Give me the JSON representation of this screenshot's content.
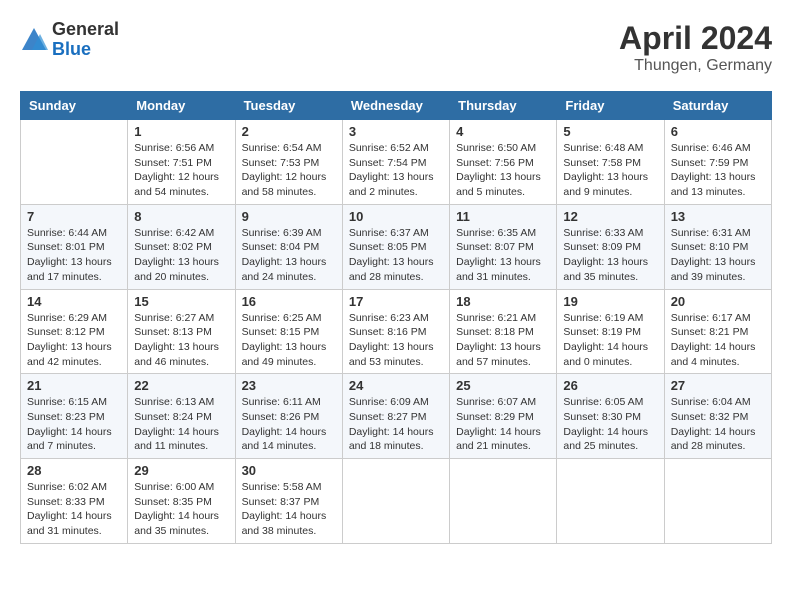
{
  "header": {
    "logo_general": "General",
    "logo_blue": "Blue",
    "month_title": "April 2024",
    "location": "Thungen, Germany"
  },
  "days_of_week": [
    "Sunday",
    "Monday",
    "Tuesday",
    "Wednesday",
    "Thursday",
    "Friday",
    "Saturday"
  ],
  "weeks": [
    [
      {
        "day": "",
        "sunrise": "",
        "sunset": "",
        "daylight": ""
      },
      {
        "day": "1",
        "sunrise": "Sunrise: 6:56 AM",
        "sunset": "Sunset: 7:51 PM",
        "daylight": "Daylight: 12 hours and 54 minutes."
      },
      {
        "day": "2",
        "sunrise": "Sunrise: 6:54 AM",
        "sunset": "Sunset: 7:53 PM",
        "daylight": "Daylight: 12 hours and 58 minutes."
      },
      {
        "day": "3",
        "sunrise": "Sunrise: 6:52 AM",
        "sunset": "Sunset: 7:54 PM",
        "daylight": "Daylight: 13 hours and 2 minutes."
      },
      {
        "day": "4",
        "sunrise": "Sunrise: 6:50 AM",
        "sunset": "Sunset: 7:56 PM",
        "daylight": "Daylight: 13 hours and 5 minutes."
      },
      {
        "day": "5",
        "sunrise": "Sunrise: 6:48 AM",
        "sunset": "Sunset: 7:58 PM",
        "daylight": "Daylight: 13 hours and 9 minutes."
      },
      {
        "day": "6",
        "sunrise": "Sunrise: 6:46 AM",
        "sunset": "Sunset: 7:59 PM",
        "daylight": "Daylight: 13 hours and 13 minutes."
      }
    ],
    [
      {
        "day": "7",
        "sunrise": "Sunrise: 6:44 AM",
        "sunset": "Sunset: 8:01 PM",
        "daylight": "Daylight: 13 hours and 17 minutes."
      },
      {
        "day": "8",
        "sunrise": "Sunrise: 6:42 AM",
        "sunset": "Sunset: 8:02 PM",
        "daylight": "Daylight: 13 hours and 20 minutes."
      },
      {
        "day": "9",
        "sunrise": "Sunrise: 6:39 AM",
        "sunset": "Sunset: 8:04 PM",
        "daylight": "Daylight: 13 hours and 24 minutes."
      },
      {
        "day": "10",
        "sunrise": "Sunrise: 6:37 AM",
        "sunset": "Sunset: 8:05 PM",
        "daylight": "Daylight: 13 hours and 28 minutes."
      },
      {
        "day": "11",
        "sunrise": "Sunrise: 6:35 AM",
        "sunset": "Sunset: 8:07 PM",
        "daylight": "Daylight: 13 hours and 31 minutes."
      },
      {
        "day": "12",
        "sunrise": "Sunrise: 6:33 AM",
        "sunset": "Sunset: 8:09 PM",
        "daylight": "Daylight: 13 hours and 35 minutes."
      },
      {
        "day": "13",
        "sunrise": "Sunrise: 6:31 AM",
        "sunset": "Sunset: 8:10 PM",
        "daylight": "Daylight: 13 hours and 39 minutes."
      }
    ],
    [
      {
        "day": "14",
        "sunrise": "Sunrise: 6:29 AM",
        "sunset": "Sunset: 8:12 PM",
        "daylight": "Daylight: 13 hours and 42 minutes."
      },
      {
        "day": "15",
        "sunrise": "Sunrise: 6:27 AM",
        "sunset": "Sunset: 8:13 PM",
        "daylight": "Daylight: 13 hours and 46 minutes."
      },
      {
        "day": "16",
        "sunrise": "Sunrise: 6:25 AM",
        "sunset": "Sunset: 8:15 PM",
        "daylight": "Daylight: 13 hours and 49 minutes."
      },
      {
        "day": "17",
        "sunrise": "Sunrise: 6:23 AM",
        "sunset": "Sunset: 8:16 PM",
        "daylight": "Daylight: 13 hours and 53 minutes."
      },
      {
        "day": "18",
        "sunrise": "Sunrise: 6:21 AM",
        "sunset": "Sunset: 8:18 PM",
        "daylight": "Daylight: 13 hours and 57 minutes."
      },
      {
        "day": "19",
        "sunrise": "Sunrise: 6:19 AM",
        "sunset": "Sunset: 8:19 PM",
        "daylight": "Daylight: 14 hours and 0 minutes."
      },
      {
        "day": "20",
        "sunrise": "Sunrise: 6:17 AM",
        "sunset": "Sunset: 8:21 PM",
        "daylight": "Daylight: 14 hours and 4 minutes."
      }
    ],
    [
      {
        "day": "21",
        "sunrise": "Sunrise: 6:15 AM",
        "sunset": "Sunset: 8:23 PM",
        "daylight": "Daylight: 14 hours and 7 minutes."
      },
      {
        "day": "22",
        "sunrise": "Sunrise: 6:13 AM",
        "sunset": "Sunset: 8:24 PM",
        "daylight": "Daylight: 14 hours and 11 minutes."
      },
      {
        "day": "23",
        "sunrise": "Sunrise: 6:11 AM",
        "sunset": "Sunset: 8:26 PM",
        "daylight": "Daylight: 14 hours and 14 minutes."
      },
      {
        "day": "24",
        "sunrise": "Sunrise: 6:09 AM",
        "sunset": "Sunset: 8:27 PM",
        "daylight": "Daylight: 14 hours and 18 minutes."
      },
      {
        "day": "25",
        "sunrise": "Sunrise: 6:07 AM",
        "sunset": "Sunset: 8:29 PM",
        "daylight": "Daylight: 14 hours and 21 minutes."
      },
      {
        "day": "26",
        "sunrise": "Sunrise: 6:05 AM",
        "sunset": "Sunset: 8:30 PM",
        "daylight": "Daylight: 14 hours and 25 minutes."
      },
      {
        "day": "27",
        "sunrise": "Sunrise: 6:04 AM",
        "sunset": "Sunset: 8:32 PM",
        "daylight": "Daylight: 14 hours and 28 minutes."
      }
    ],
    [
      {
        "day": "28",
        "sunrise": "Sunrise: 6:02 AM",
        "sunset": "Sunset: 8:33 PM",
        "daylight": "Daylight: 14 hours and 31 minutes."
      },
      {
        "day": "29",
        "sunrise": "Sunrise: 6:00 AM",
        "sunset": "Sunset: 8:35 PM",
        "daylight": "Daylight: 14 hours and 35 minutes."
      },
      {
        "day": "30",
        "sunrise": "Sunrise: 5:58 AM",
        "sunset": "Sunset: 8:37 PM",
        "daylight": "Daylight: 14 hours and 38 minutes."
      },
      {
        "day": "",
        "sunrise": "",
        "sunset": "",
        "daylight": ""
      },
      {
        "day": "",
        "sunrise": "",
        "sunset": "",
        "daylight": ""
      },
      {
        "day": "",
        "sunrise": "",
        "sunset": "",
        "daylight": ""
      },
      {
        "day": "",
        "sunrise": "",
        "sunset": "",
        "daylight": ""
      }
    ]
  ]
}
